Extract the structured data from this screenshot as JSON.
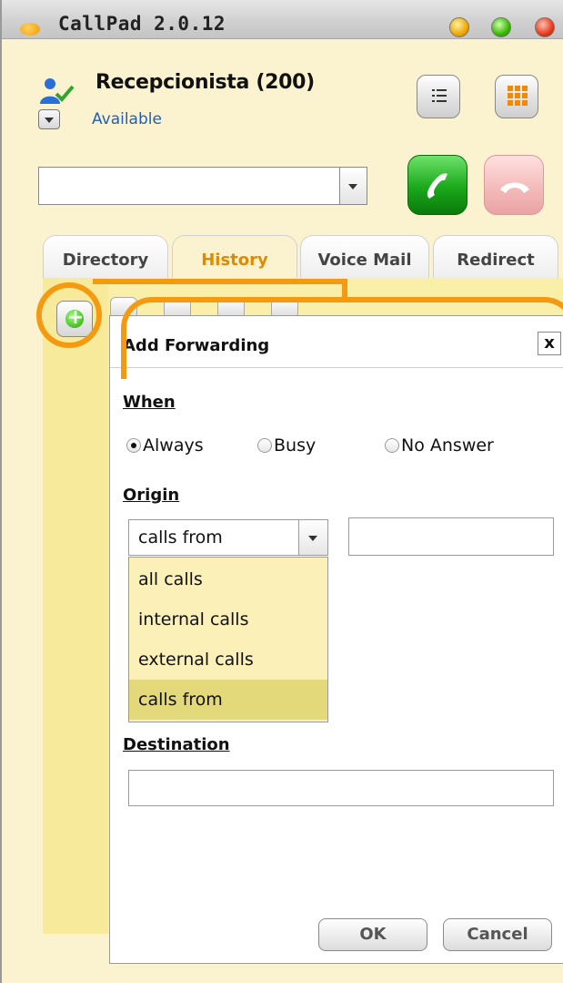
{
  "window": {
    "title": "CallPad 2.0.12"
  },
  "user": {
    "name": "Recepcionista (200)",
    "status": "Available"
  },
  "dial": {
    "value": ""
  },
  "tabs": [
    {
      "label": "Directory"
    },
    {
      "label": "History"
    },
    {
      "label": "Voice Mail"
    },
    {
      "label": "Redirect"
    }
  ],
  "dialog": {
    "title": "Add Forwarding",
    "close_label": "x",
    "when_label": "When",
    "when_options": [
      {
        "label": "Always",
        "selected": true
      },
      {
        "label": "Busy",
        "selected": false
      },
      {
        "label": "No Answer",
        "selected": false
      }
    ],
    "origin_label": "Origin",
    "origin_selected": "calls from",
    "origin_options": [
      "all calls",
      "internal calls",
      "external calls",
      "calls from"
    ],
    "origin_number": "",
    "destination_label": "Destination",
    "destination_value": "",
    "ok_label": "OK",
    "cancel_label": "Cancel"
  },
  "colors": {
    "accent_highlight": "#f39a11",
    "history_tab": "#e08a00",
    "status_link": "#1e5fb8",
    "panel_bg": "#f9efa8"
  }
}
